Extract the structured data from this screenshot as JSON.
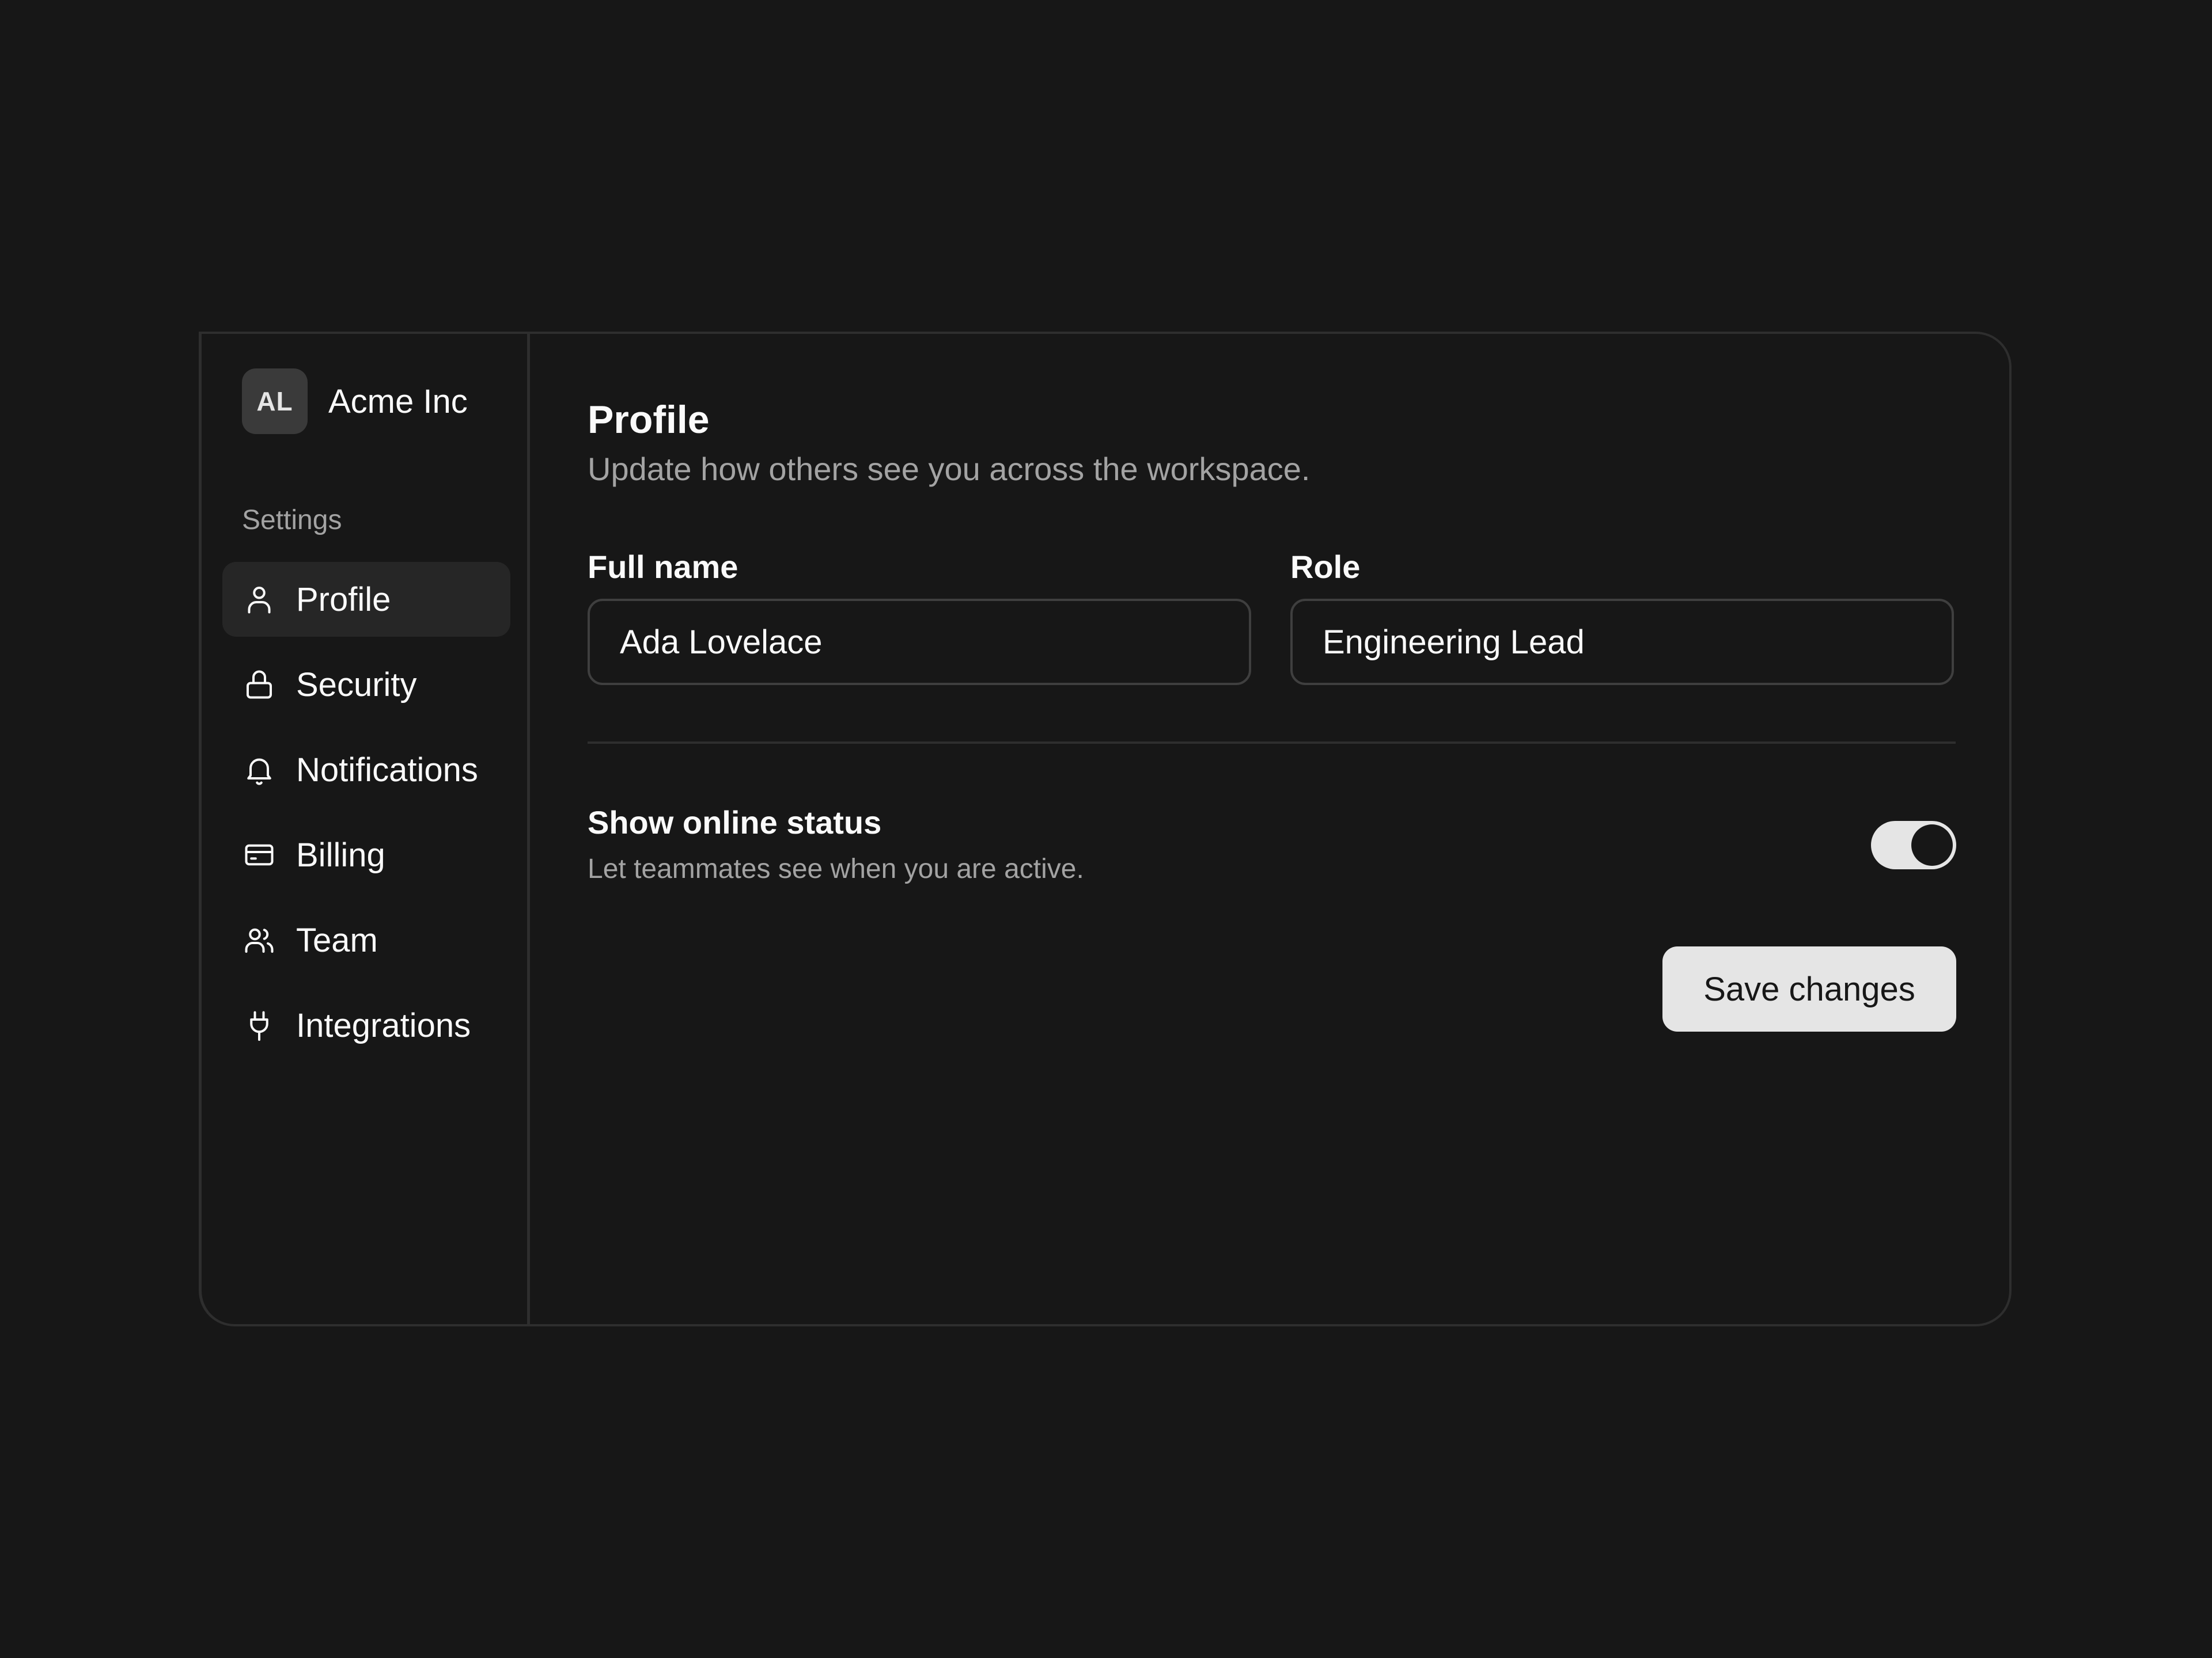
{
  "workspace": {
    "avatar_initials": "AL",
    "name": "Acme Inc"
  },
  "sidebar": {
    "section_label": "Settings",
    "items": [
      {
        "label": "Profile",
        "icon": "user-icon",
        "active": true
      },
      {
        "label": "Security",
        "icon": "lock-icon",
        "active": false
      },
      {
        "label": "Notifications",
        "icon": "bell-icon",
        "active": false
      },
      {
        "label": "Billing",
        "icon": "credit-card-icon",
        "active": false
      },
      {
        "label": "Team",
        "icon": "users-icon",
        "active": false
      },
      {
        "label": "Integrations",
        "icon": "plug-icon",
        "active": false
      }
    ]
  },
  "main": {
    "title": "Profile",
    "subtitle": "Update how others see you across the workspace.",
    "fields": {
      "full_name": {
        "label": "Full name",
        "value": "Ada Lovelace"
      },
      "role": {
        "label": "Role",
        "value": "Engineering Lead"
      }
    },
    "online_status": {
      "title": "Show online status",
      "description": "Let teammates see when you are active.",
      "enabled": true
    },
    "save_label": "Save changes"
  },
  "colors": {
    "background": "#171717",
    "border": "#2e2e2e",
    "active_item": "#262626",
    "button": "#e5e5e5"
  }
}
